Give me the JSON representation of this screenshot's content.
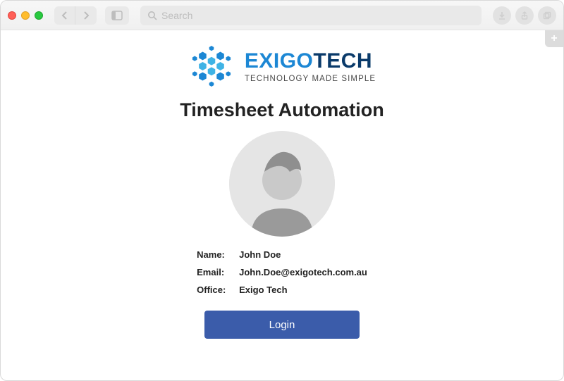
{
  "browser": {
    "search_placeholder": "Search"
  },
  "logo": {
    "brand_prefix": "EXIGO",
    "brand_suffix": "TECH",
    "tagline": "TECHNOLOGY MADE SIMPLE"
  },
  "page": {
    "heading": "Timesheet Automation"
  },
  "user": {
    "name_label": "Name:",
    "name_value": "John Doe",
    "email_label": "Email:",
    "email_value": "John.Doe@exigotech.com.au",
    "office_label": "Office:",
    "office_value": "Exigo Tech"
  },
  "actions": {
    "login_label": "Login"
  }
}
